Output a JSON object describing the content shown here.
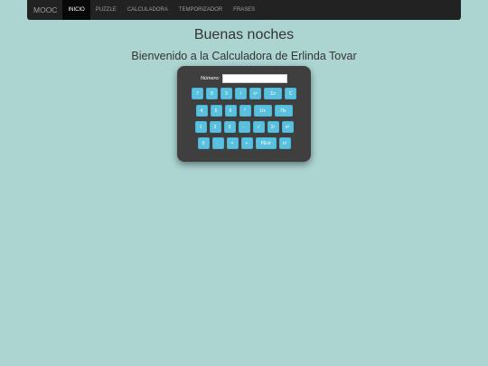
{
  "navbar": {
    "brand": "MOOC",
    "items": [
      {
        "label": "INICIO",
        "active": true
      },
      {
        "label": "PUZZLE",
        "active": false
      },
      {
        "label": "CALCULADORA",
        "active": false
      },
      {
        "label": "TEMPORIZADOR",
        "active": false
      },
      {
        "label": "FRASES",
        "active": false
      }
    ]
  },
  "main": {
    "title": "Buenas noches",
    "subtitle": "Bienvenido a la Calculadora de Erlinda Tovar"
  },
  "calculator": {
    "display_label": "Número:",
    "display_value": "",
    "rows": [
      [
        "7",
        "8",
        "9",
        "/",
        "x²",
        "Σx",
        "C"
      ],
      [
        "4",
        "5",
        "6",
        "*",
        "1/x",
        "Πx"
      ],
      [
        "1",
        "2",
        "3",
        "-",
        "√",
        "2ˣ",
        "x³"
      ],
      [
        "0",
        ".",
        "=",
        "+",
        "PEnt",
        "n!"
      ]
    ]
  },
  "colors": {
    "background": "#acd5d2",
    "navbar": "#222222",
    "calculator_body": "#3f3f3f",
    "key": "#5bc0de"
  }
}
